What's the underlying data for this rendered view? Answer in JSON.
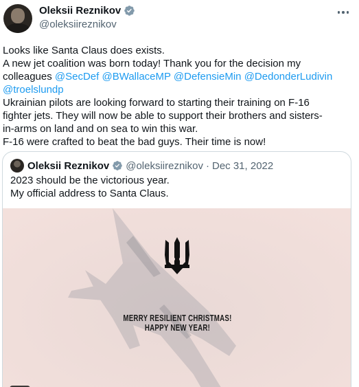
{
  "author": {
    "name": "Oleksii Reznikov",
    "handle": "@oleksiireznikov",
    "verified_icon": "verified-badge-icon",
    "more_icon": "more-options-icon"
  },
  "tweet": {
    "line1": "Looks like Santa Claus does exists.",
    "line2": "A new jet coalition was born today! Thank you for the decision my",
    "line3_prefix": "colleagues ",
    "mentions": [
      "@SecDef",
      "@BWallaceMP",
      "@DefensieMin",
      "@DedonderLudivin",
      "@troelslundp"
    ],
    "line5": "Ukrainian pilots are looking forward to starting their training on F-16",
    "line6": "fighter jets. They will now be able to support their brothers and sisters-",
    "line7": "in-arms on land and on sea to win this war.",
    "line8": "F-16 were crafted to beat the bad guys. Their time is now!"
  },
  "quoted_tweet": {
    "name": "Oleksii Reznikov",
    "handle": "@oleksiireznikov",
    "separator": "·",
    "date": "Dec 31, 2022",
    "text_line1": "2023 should be the victorious year.",
    "text_line2": "My official address to Santa Claus.",
    "media": {
      "greeting_line1": "MERRY RESILIENT CHRISTMAS!",
      "greeting_line2": "HAPPY NEW YEAR!",
      "background_color": "#f2dfdc",
      "emblem_icon": "trident-icon"
    }
  },
  "colors": {
    "text": "#0f1419",
    "secondary": "#536471",
    "link": "#1d9bf0",
    "border": "#cfd9de"
  }
}
